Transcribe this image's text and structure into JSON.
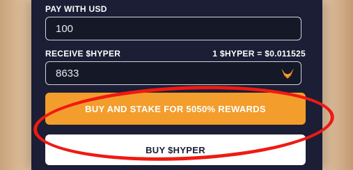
{
  "pay": {
    "label": "PAY WITH USD",
    "value": "100"
  },
  "receive": {
    "label": "RECEIVE $HYPER",
    "rate": "1 $HYPER = $0.011525",
    "value": "8633",
    "token_icon": "hyper-token-icon"
  },
  "buttons": {
    "buy_and_stake": "BUY AND STAKE FOR 5050% REWARDS",
    "buy": "BUY $HYPER"
  },
  "colors": {
    "panel": "#1b1e35",
    "accent_orange": "#f39d2c",
    "annotation_red": "#ef1a12"
  }
}
